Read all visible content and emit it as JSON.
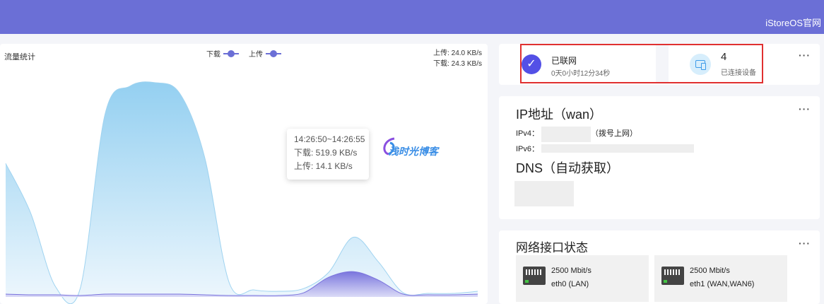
{
  "topbar": {
    "brand": "iStoreOS官网"
  },
  "traffic": {
    "title": "流量统计",
    "legend": {
      "download": "下载",
      "upload": "上传"
    },
    "rates": {
      "upload": "上传: 24.0 KB/s",
      "download": "下载: 24.3 KB/s"
    },
    "tooltip": {
      "time": "14:26:50~14:26:55",
      "download": "下载: 519.9 KB/s",
      "upload": "上传: 14.1 KB/s"
    },
    "watermark": "浅时光博客"
  },
  "chart_data": {
    "type": "area",
    "title": "流量统计",
    "series": [
      {
        "name": "下载",
        "color": "#9fd3f0",
        "values": [
          190,
          120,
          15,
          12,
          260,
          300,
          305,
          290,
          200,
          20,
          10,
          8,
          12,
          35,
          85,
          50,
          6,
          5,
          5,
          8
        ]
      },
      {
        "name": "上传",
        "color": "#7b74dd",
        "values": [
          4,
          3,
          3,
          2,
          4,
          4,
          4,
          4,
          3,
          2,
          2,
          2,
          6,
          28,
          36,
          24,
          4,
          3,
          3,
          4
        ]
      }
    ],
    "grid": false,
    "legend": "top-center"
  },
  "status": {
    "connected": {
      "label": "已联网",
      "uptime": "0天0小时12分34秒"
    },
    "devices": {
      "count": "4",
      "label": "已连接设备"
    },
    "more": "···"
  },
  "ip": {
    "title": "IP地址（wan）",
    "ipv4_label": "IPv4：",
    "ipv4_suffix": "（拨号上网）",
    "ipv6_label": "IPv6：",
    "dns_title": "DNS（自动获取）",
    "more": "···"
  },
  "network": {
    "title": "网络接口状态",
    "more": "···",
    "ports": [
      {
        "speed": "2500 Mbit/s",
        "name": "eth0 (LAN)"
      },
      {
        "speed": "2500 Mbit/s",
        "name": "eth1 (WAN,WAN6)"
      }
    ]
  }
}
